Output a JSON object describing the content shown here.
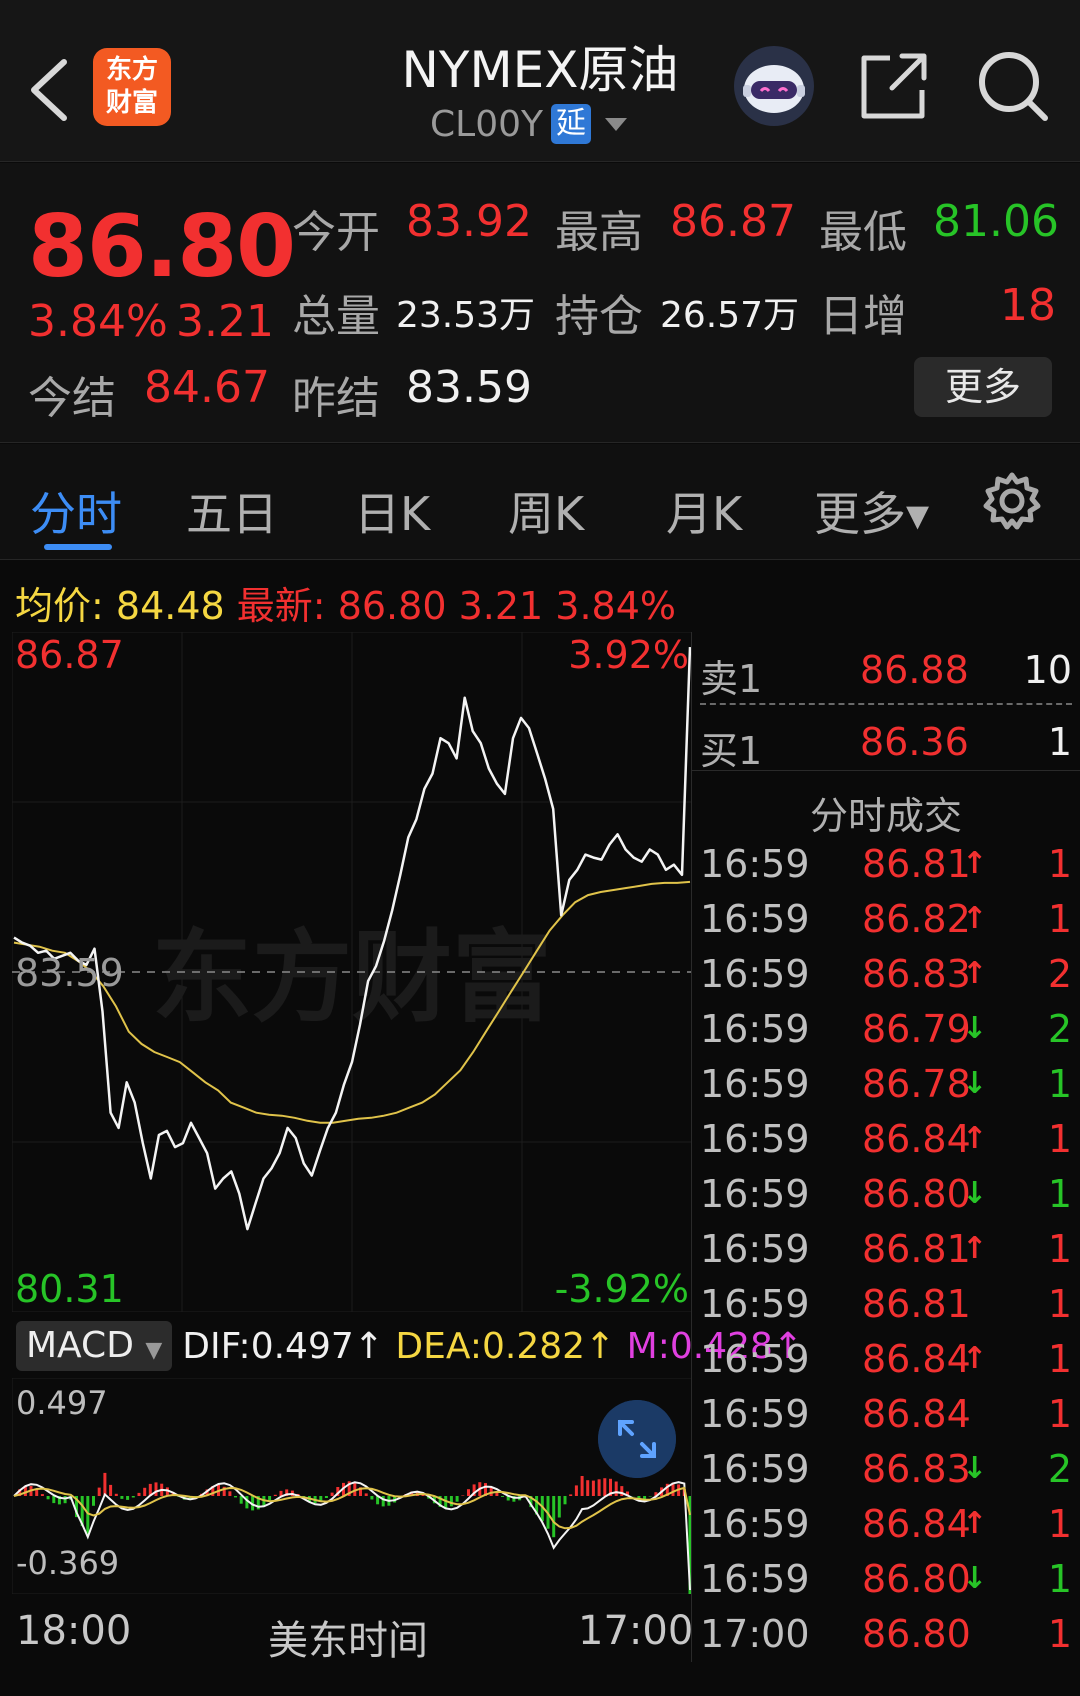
{
  "header": {
    "title": "NYMEX原油",
    "code": "CL00Y",
    "delay_badge": "延",
    "logo_lines": [
      "东方",
      "财富"
    ]
  },
  "quote": {
    "price": "86.80",
    "change_pct": "3.84%",
    "change": "3.21",
    "open_label": "今开",
    "open": "83.92",
    "high_label": "最高",
    "high": "86.87",
    "low_label": "最低",
    "low": "81.06",
    "volume_label": "总量",
    "volume": "23.53万",
    "position_label": "持仓",
    "position": "26.57万",
    "daily_add_label": "日增",
    "daily_add": "18",
    "settle_label": "今结",
    "settle": "84.67",
    "prev_settle_label": "昨结",
    "prev_settle": "83.59",
    "more_label": "更多"
  },
  "tabs": [
    "分时",
    "五日",
    "日K",
    "周K",
    "月K",
    "更多▾"
  ],
  "infobar": {
    "avg_label": "均价:",
    "avg": "84.48",
    "latest_label": "最新:",
    "latest": "86.80",
    "chg": "3.21",
    "pct": "3.84%"
  },
  "chart": {
    "y_max": "86.87",
    "y_mid": "83.59",
    "y_min": "80.31",
    "pct_max": "3.92%",
    "pct_min": "-3.92%",
    "watermark": "东方财富",
    "x_start": "18:00",
    "x_mid": "美东时间",
    "x_end": "17:00"
  },
  "chart_data": {
    "type": "line",
    "x_range": [
      "18:00",
      "17:00"
    ],
    "ylim": [
      80.31,
      86.87
    ],
    "reference": 83.59,
    "series": [
      {
        "name": "最新",
        "color": "#ffffff",
        "values": [
          83.93,
          83.88,
          83.85,
          83.78,
          83.8,
          83.72,
          83.75,
          83.78,
          83.7,
          83.66,
          83.82,
          83.2,
          82.2,
          82.05,
          82.5,
          82.3,
          81.9,
          81.55,
          81.98,
          82.02,
          81.86,
          81.9,
          82.1,
          81.95,
          81.8,
          81.45,
          81.55,
          81.62,
          81.4,
          81.05,
          81.3,
          81.55,
          81.65,
          81.8,
          82.05,
          81.95,
          81.7,
          81.58,
          81.82,
          82.05,
          82.2,
          82.48,
          82.7,
          83.07,
          83.5,
          83.65,
          83.9,
          84.2,
          84.55,
          84.92,
          85.1,
          85.4,
          85.55,
          85.9,
          85.85,
          85.7,
          86.3,
          85.97,
          85.85,
          85.6,
          85.45,
          85.35,
          85.9,
          86.1,
          86.0,
          85.75,
          85.5,
          85.2,
          84.15,
          84.5,
          84.6,
          84.75,
          84.72,
          84.7,
          84.85,
          84.95,
          84.8,
          84.72,
          84.68,
          84.8,
          84.75,
          84.6,
          84.65,
          84.55,
          86.8
        ]
      },
      {
        "name": "均价",
        "color": "#e0c34a",
        "values": [
          83.88,
          83.86,
          83.84,
          83.8,
          83.78,
          83.7,
          83.6,
          83.45,
          83.25,
          83.0,
          82.88,
          82.8,
          82.75,
          82.7,
          82.6,
          82.5,
          82.42,
          82.3,
          82.25,
          82.2,
          82.18,
          82.17,
          82.15,
          82.12,
          82.1,
          82.1,
          82.12,
          82.14,
          82.15,
          82.17,
          82.2,
          82.25,
          82.3,
          82.38,
          82.5,
          82.62,
          82.8,
          83.0,
          83.2,
          83.4,
          83.6,
          83.8,
          84.0,
          84.15,
          84.28,
          84.35,
          84.38,
          84.4,
          84.42,
          84.44,
          84.46,
          84.47,
          84.47,
          84.48
        ]
      }
    ]
  },
  "macd": {
    "label": "MACD",
    "dif_label": "DIF:",
    "dif": "0.497",
    "dea_label": "DEA:",
    "dea": "0.282",
    "m_label": "M:",
    "m": "0.428",
    "y_max": "0.497",
    "y_min": "-0.369"
  },
  "orderbook": {
    "ask_label": "卖1",
    "ask_price": "86.88",
    "ask_vol": "10",
    "bid_label": "买1",
    "bid_price": "86.36",
    "bid_vol": "1",
    "trades_title": "分时成交",
    "trades": [
      {
        "t": "16:59",
        "p": "86.81",
        "a": "up",
        "v": "1"
      },
      {
        "t": "16:59",
        "p": "86.82",
        "a": "up",
        "v": "1"
      },
      {
        "t": "16:59",
        "p": "86.83",
        "a": "up",
        "v": "2"
      },
      {
        "t": "16:59",
        "p": "86.79",
        "a": "down",
        "v": "2"
      },
      {
        "t": "16:59",
        "p": "86.78",
        "a": "down",
        "v": "1"
      },
      {
        "t": "16:59",
        "p": "86.84",
        "a": "up",
        "v": "1"
      },
      {
        "t": "16:59",
        "p": "86.80",
        "a": "down",
        "v": "1"
      },
      {
        "t": "16:59",
        "p": "86.81",
        "a": "up",
        "v": "1"
      },
      {
        "t": "16:59",
        "p": "86.81",
        "a": "",
        "v": "1"
      },
      {
        "t": "16:59",
        "p": "86.84",
        "a": "up",
        "v": "1"
      },
      {
        "t": "16:59",
        "p": "86.84",
        "a": "",
        "v": "1"
      },
      {
        "t": "16:59",
        "p": "86.83",
        "a": "down",
        "v": "2"
      },
      {
        "t": "16:59",
        "p": "86.84",
        "a": "up",
        "v": "1"
      },
      {
        "t": "16:59",
        "p": "86.80",
        "a": "down",
        "v": "1"
      },
      {
        "t": "17:00",
        "p": "86.80",
        "a": "",
        "v": "1"
      }
    ]
  },
  "colors": {
    "up": "#f23030",
    "down": "#27c427",
    "accent": "#3d8df5",
    "avg_line": "#e0c34a"
  }
}
